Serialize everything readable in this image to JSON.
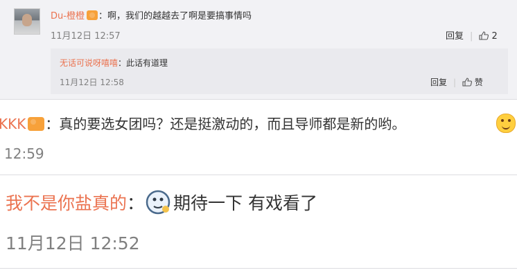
{
  "comment1": {
    "username": "Du-橙橙",
    "text": "：啊，我们的越越去了啊是要搞事情吗",
    "timestamp": "11月12日 12:57",
    "reply_label": "回复",
    "like_count": "2"
  },
  "reply1": {
    "username": "无话可说呀嘻嘻",
    "text": "：此话有道理",
    "timestamp": "11月12日 12:58",
    "reply_label": "回复",
    "like_label": "赞"
  },
  "comment2": {
    "username": "KKK",
    "text": "：真的要选女团吗？还是挺激动的，而且导师都是新的哟。",
    "timestamp": "12:59"
  },
  "comment3": {
    "username": "我不是你盐真的",
    "colon": "：",
    "text": "期待一下 有戏看了",
    "timestamp": "11月12日 12:52"
  },
  "colors": {
    "username": "#eb7350",
    "meta": "#808080",
    "panel": "#f2f2f5"
  },
  "icons": [
    "avatar-photo",
    "member-badge-icon",
    "thumbs-up-icon",
    "smile-emoji",
    "sticker-emoji"
  ]
}
